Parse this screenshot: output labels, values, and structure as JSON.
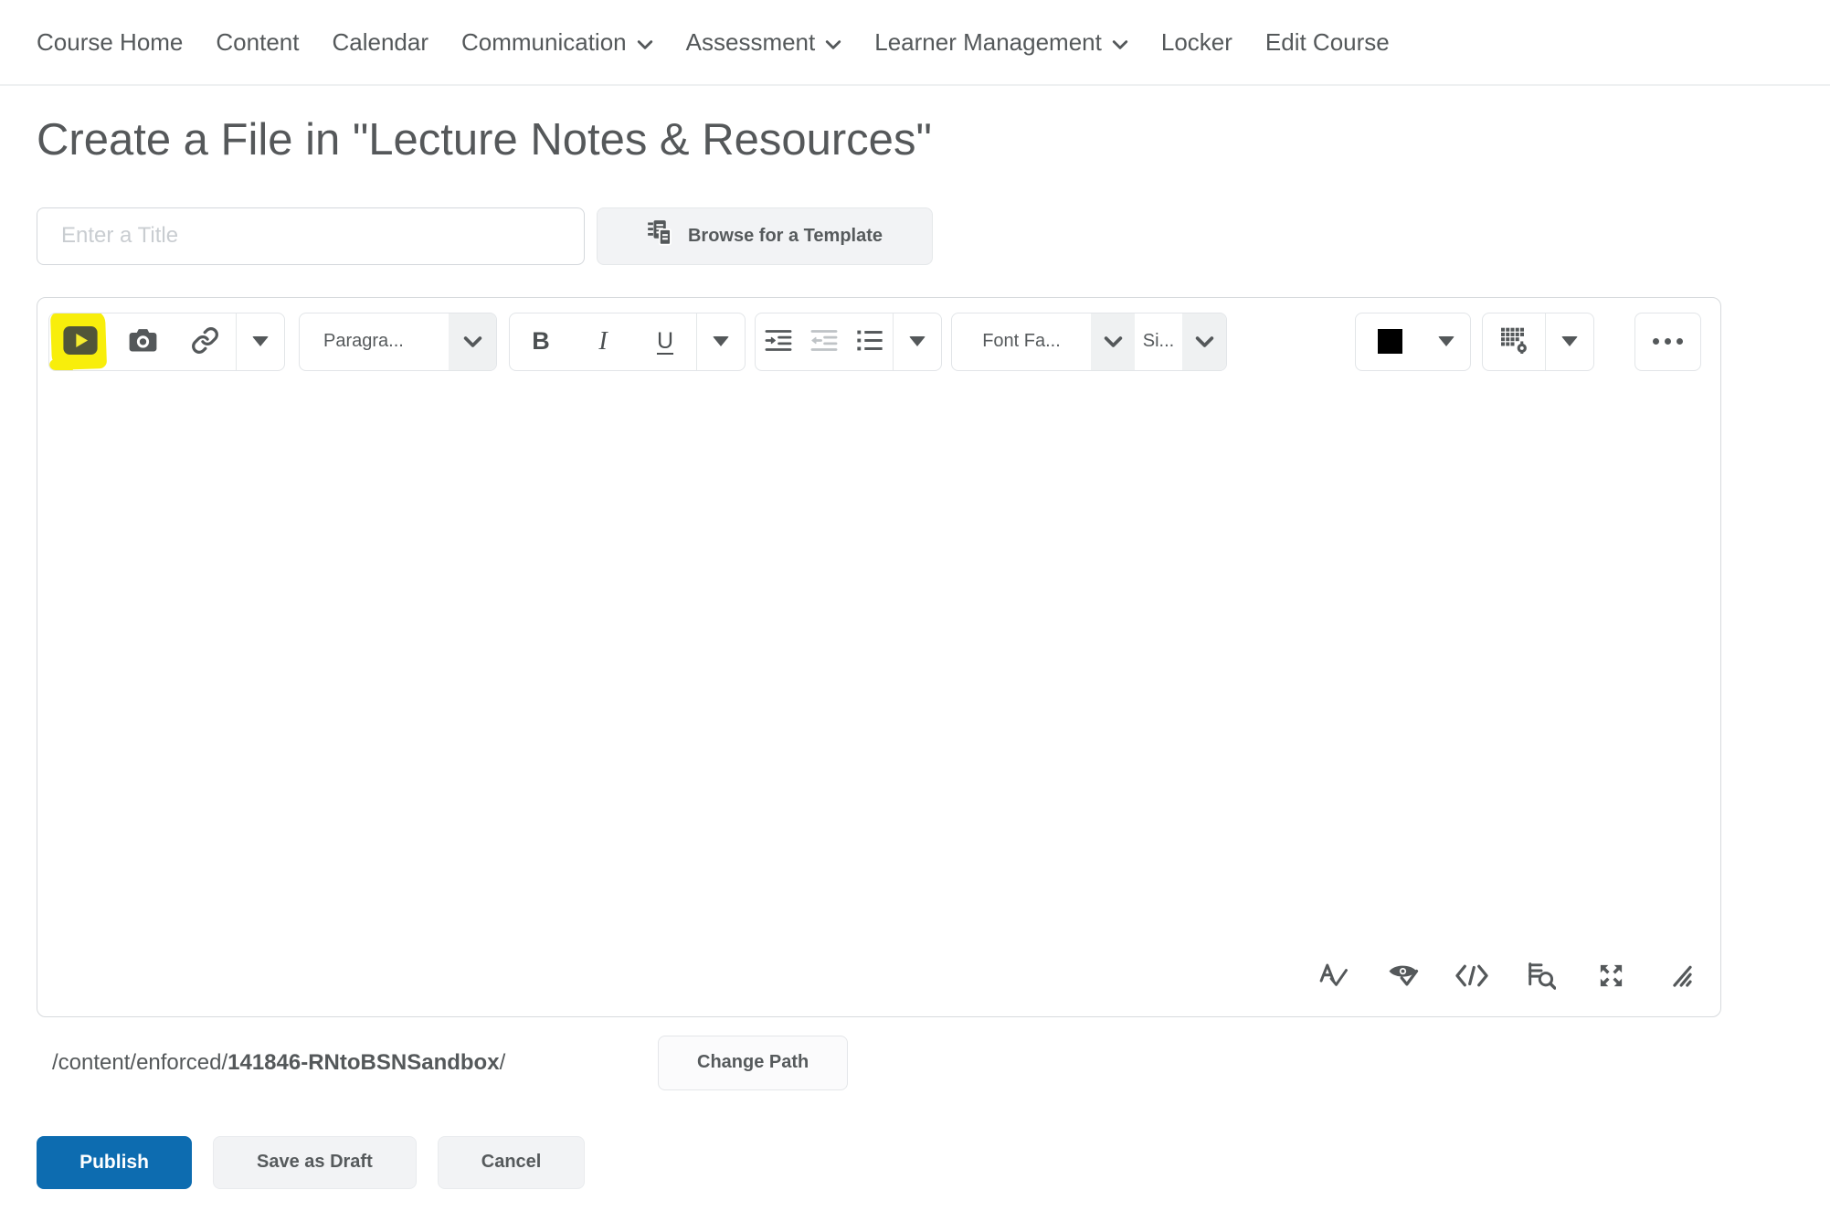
{
  "nav": {
    "items": [
      {
        "id": "course-home",
        "label": "Course Home",
        "dropdown": false
      },
      {
        "id": "content",
        "label": "Content",
        "dropdown": false
      },
      {
        "id": "calendar",
        "label": "Calendar",
        "dropdown": false
      },
      {
        "id": "communication",
        "label": "Communication",
        "dropdown": true
      },
      {
        "id": "assessment",
        "label": "Assessment",
        "dropdown": true
      },
      {
        "id": "learner-management",
        "label": "Learner Management",
        "dropdown": true
      },
      {
        "id": "locker",
        "label": "Locker",
        "dropdown": false
      },
      {
        "id": "edit-course",
        "label": "Edit Course",
        "dropdown": false
      }
    ]
  },
  "page": {
    "title": "Create a File in \"Lecture Notes & Resources\""
  },
  "form": {
    "title_placeholder": "Enter a Title",
    "browse_template_label": "Browse for a Template"
  },
  "editor": {
    "toolbar": {
      "paragraph_label": "Paragra...",
      "bold_label": "B",
      "italic_label": "I",
      "underline_label": "U",
      "font_family_label": "Font Fa...",
      "font_size_label": "Si..."
    }
  },
  "path": {
    "prefix": "/content/enforced/",
    "folder": "141846-RNtoBSNSandbox",
    "suffix": "/",
    "change_button_label": "Change Path"
  },
  "actions": {
    "publish_label": "Publish",
    "save_draft_label": "Save as Draft",
    "cancel_label": "Cancel"
  },
  "icons": {
    "video-play": "▶",
    "camera": "📷",
    "link": "🔗",
    "dropdown-caret": "▼",
    "select-chevron": "⌄",
    "indent": "→≡",
    "outdent": "←≡",
    "bullet-list": "≔",
    "text-color-swatch": "■",
    "table": "▦",
    "more": "…",
    "spellcheck": "A✓",
    "accessibility-check": "◉✓",
    "html-source": "</>",
    "preview": "🔍",
    "fullscreen": "⛶",
    "resize-handle": "⫽",
    "browse-template": "🗐"
  },
  "colors": {
    "publish_blue": "#0d6cb0",
    "highlight_yellow": "#f8ee0b",
    "text_gray": "#54585a"
  }
}
